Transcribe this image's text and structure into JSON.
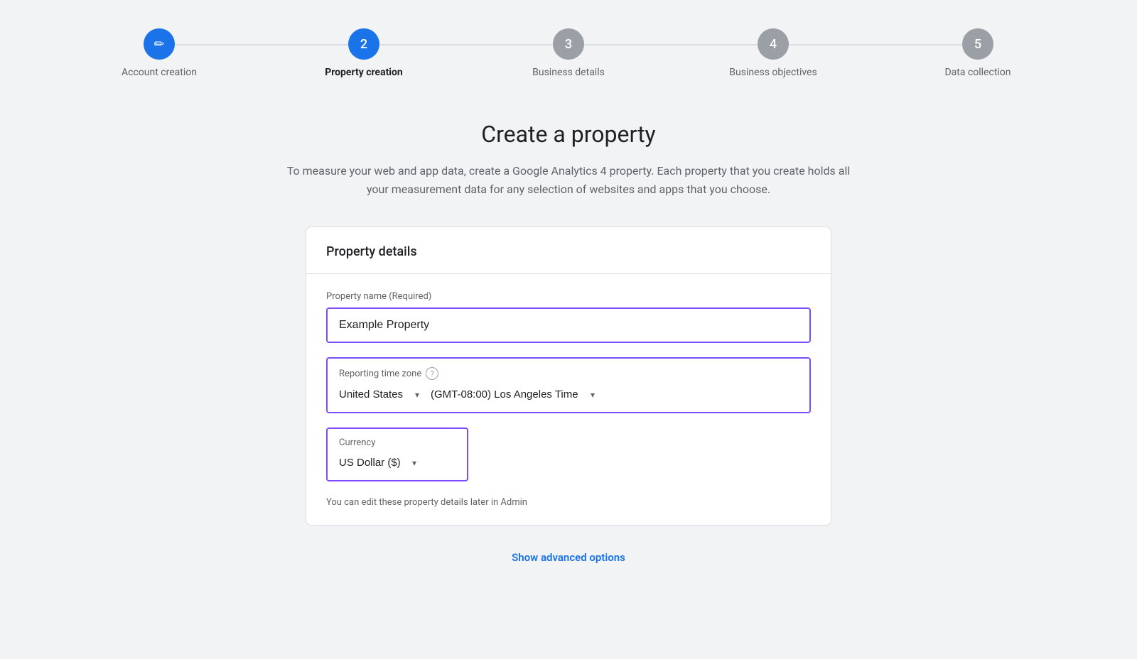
{
  "stepper": {
    "steps": [
      {
        "id": "account-creation",
        "number": "✏",
        "label": "Account creation",
        "state": "completed",
        "icon": "pencil"
      },
      {
        "id": "property-creation",
        "number": "2",
        "label": "Property creation",
        "state": "active"
      },
      {
        "id": "business-details",
        "number": "3",
        "label": "Business details",
        "state": "inactive"
      },
      {
        "id": "business-objectives",
        "number": "4",
        "label": "Business objectives",
        "state": "inactive"
      },
      {
        "id": "data-collection",
        "number": "5",
        "label": "Data collection",
        "state": "inactive"
      }
    ]
  },
  "page": {
    "title": "Create a property",
    "description": "To measure your web and app data, create a Google Analytics 4 property. Each property that you create holds all your measurement data for any selection of websites and apps that you choose."
  },
  "card": {
    "header": "Property details",
    "property_name_label": "Property name (Required)",
    "property_name_value": "Example Property",
    "reporting_tz_label": "Reporting time zone",
    "help_icon_label": "?",
    "country_value": "United States",
    "timezone_value": "(GMT-08:00) Los Angeles Time",
    "currency_label": "Currency",
    "currency_value": "US Dollar ($)",
    "edit_hint": "You can edit these property details later in Admin"
  },
  "advanced": {
    "label": "Show advanced options"
  },
  "colors": {
    "active_step": "#1a73e8",
    "inactive_step": "#9aa0a6",
    "focus_border": "#7c4dff",
    "link": "#1a73e8"
  }
}
